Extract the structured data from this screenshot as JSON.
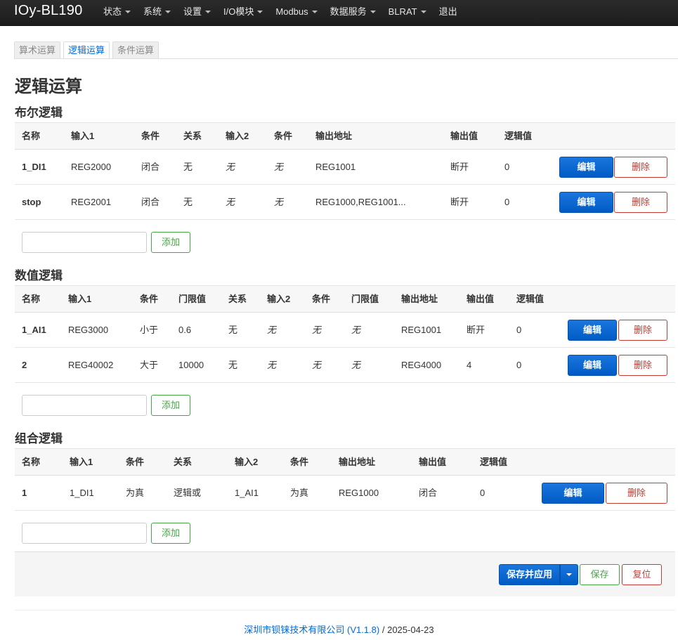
{
  "brand": "IOy-BL190",
  "nav": [
    {
      "label": "状态",
      "caret": true
    },
    {
      "label": "系统",
      "caret": true
    },
    {
      "label": "设置",
      "caret": true
    },
    {
      "label": "I/O模块",
      "caret": true
    },
    {
      "label": "Modbus",
      "caret": true
    },
    {
      "label": "数据服务",
      "caret": true
    },
    {
      "label": "BLRAT",
      "caret": true
    },
    {
      "label": "退出",
      "caret": false
    }
  ],
  "tabs": [
    {
      "label": "算术运算",
      "active": false
    },
    {
      "label": "逻辑运算",
      "active": true
    },
    {
      "label": "条件运算",
      "active": false
    }
  ],
  "page_title": "逻辑运算",
  "bool_logic": {
    "title": "布尔逻辑",
    "headers": [
      "名称",
      "输入1",
      "条件",
      "关系",
      "输入2",
      "条件",
      "输出地址",
      "输出值",
      "逻辑值"
    ],
    "rows": [
      [
        "1_DI1",
        "REG2000",
        "闭合",
        "无",
        "无",
        "无",
        "REG1001",
        "断开",
        "0"
      ],
      [
        "stop",
        "REG2001",
        "闭合",
        "无",
        "无",
        "无",
        "REG1000,REG1001...",
        "断开",
        "0"
      ]
    ]
  },
  "num_logic": {
    "title": "数值逻辑",
    "headers": [
      "名称",
      "输入1",
      "条件",
      "门限值",
      "关系",
      "输入2",
      "条件",
      "门限值",
      "输出地址",
      "输出值",
      "逻辑值"
    ],
    "rows": [
      [
        "1_AI1",
        "REG3000",
        "小于",
        "0.6",
        "无",
        "无",
        "无",
        "无",
        "REG1001",
        "断开",
        "0"
      ],
      [
        "2",
        "REG40002",
        "大于",
        "10000",
        "无",
        "无",
        "无",
        "无",
        "REG4000",
        "4",
        "0"
      ]
    ]
  },
  "combo_logic": {
    "title": "组合逻辑",
    "headers": [
      "名称",
      "输入1",
      "条件",
      "关系",
      "输入2",
      "条件",
      "输出地址",
      "输出值",
      "逻辑值"
    ],
    "rows": [
      [
        "1",
        "1_DI1",
        "为真",
        "逻辑或",
        "1_AI1",
        "为真",
        "REG1000",
        "闭合",
        "0"
      ]
    ]
  },
  "buttons": {
    "edit": "编辑",
    "delete": "删除",
    "add": "添加",
    "save_apply": "保存并应用",
    "save": "保存",
    "reset": "复位"
  },
  "footer": {
    "link": "深圳市钡铼技术有限公司 (V1.1.8)",
    "date": " / 2025-04-23"
  }
}
